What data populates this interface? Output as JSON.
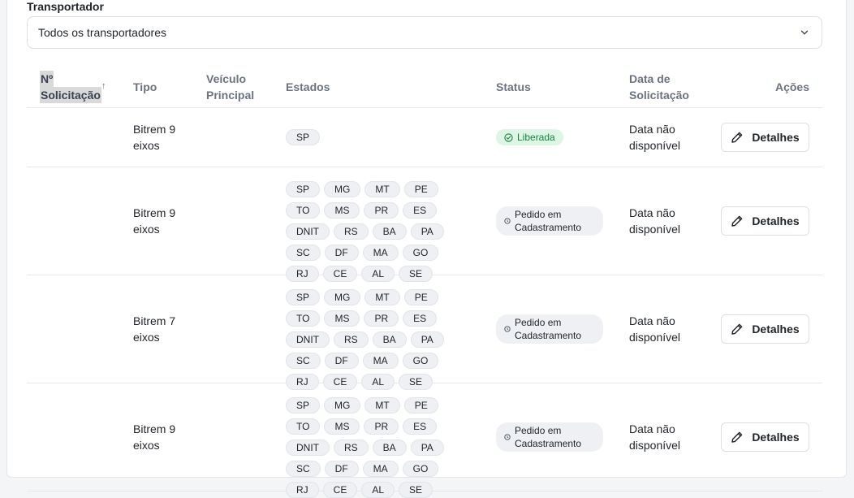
{
  "filter": {
    "label": "Transportador",
    "selected": "Todos os transportadores"
  },
  "table": {
    "headers": {
      "num_line1": "Nº",
      "num_line2": "Solicitação",
      "sort": "↑",
      "tipo": "Tipo",
      "veiculo": "Veículo Principal",
      "estados": "Estados",
      "status": "Status",
      "data": "Data de Solicitação",
      "acoes": "Ações"
    },
    "rows": [
      {
        "tipo": "Bitrem 9 eixos",
        "estados": [
          "SP"
        ],
        "status": "Liberada",
        "data": "Data não disponível",
        "action": "Detalhes"
      },
      {
        "tipo": "Bitrem 9 eixos",
        "estados": [
          "SP",
          "MG",
          "MT",
          "PE",
          "TO",
          "MS",
          "PR",
          "ES",
          "DNIT",
          "RS",
          "BA",
          "PA",
          "SC",
          "DF",
          "MA",
          "GO",
          "RJ",
          "CE",
          "AL",
          "SE"
        ],
        "status": "Pedido em Cadastramento",
        "data": "Data não disponível",
        "action": "Detalhes"
      },
      {
        "tipo": "Bitrem 7 eixos",
        "estados": [
          "SP",
          "MG",
          "MT",
          "PE",
          "TO",
          "MS",
          "PR",
          "ES",
          "DNIT",
          "RS",
          "BA",
          "PA",
          "SC",
          "DF",
          "MA",
          "GO",
          "RJ",
          "CE",
          "AL",
          "SE"
        ],
        "status": "Pedido em Cadastramento",
        "data": "Data não disponível",
        "action": "Detalhes"
      },
      {
        "tipo": "Bitrem 9 eixos",
        "estados": [
          "SP",
          "MG",
          "MT",
          "PE",
          "TO",
          "MS",
          "PR",
          "ES",
          "DNIT",
          "RS",
          "BA",
          "PA",
          "SC",
          "DF",
          "MA",
          "GO",
          "RJ",
          "CE",
          "AL",
          "SE"
        ],
        "status": "Pedido em Cadastramento",
        "data": "Data não disponível",
        "action": "Detalhes"
      }
    ]
  },
  "colors": {
    "success_bg": "#dcf5e4",
    "success_text": "#15803d",
    "chip_bg": "#eef0f3",
    "header_text": "#6b7280"
  }
}
